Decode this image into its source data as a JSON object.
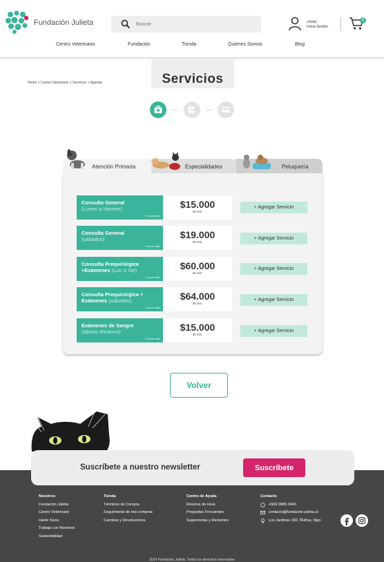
{
  "brand": "Fundación Julieta",
  "search": {
    "placeholder": "Buscar"
  },
  "user": {
    "greeting": "¡Hola!",
    "login": "Inicia Sesión"
  },
  "cart": {
    "count": "0"
  },
  "nav": [
    "Centro Veterinario",
    "Fundación",
    "Tienda",
    "Quienes Somos",
    "Blog"
  ],
  "breadcrumb": "Home > Centro Veterinario > Servicios > Agenda",
  "page_title": "Servicios",
  "tabs": [
    "Atención Primaria",
    "Especialidades",
    "Peluquería"
  ],
  "services": [
    {
      "name": "Consulta General",
      "sub": "(Lunes a Viernes)",
      "price": "$15.000",
      "duration": "30 min.",
      "more": "Conoce Más",
      "add": "+ Agregar Servicio"
    },
    {
      "name": "Consulta General",
      "sub": "(sábados)",
      "price": "$19.000",
      "duration": "30 min.",
      "more": "Conoce Más",
      "add": "+ Agregar Servicio"
    },
    {
      "name": "Consulta Prequirúrgica +Exámenes",
      "sub": "(Lun a Vie)",
      "price": "$60.000",
      "duration": "30 min.",
      "more": "Conoce Más",
      "add": "+ Agregar Servicio"
    },
    {
      "name": "Consulta Prequirúrgica + Exámenes",
      "sub": "(sábados)",
      "price": "$64.000",
      "duration": "30 min.",
      "more": "Conoce Más",
      "add": "+ Agregar Servicio"
    },
    {
      "name": "Exámenes de Sangre",
      "sub": "(Abono Reserva)",
      "price": "$15.000",
      "duration": "30 min.",
      "more": "Conoce Más",
      "add": "+ Agregar Servicio"
    }
  ],
  "back_button": "Volver",
  "newsletter": {
    "text": "Suscríbete a nuestro newsletter",
    "button": "Suscríbete"
  },
  "footer": {
    "cols": [
      {
        "title": "Nosotros",
        "links": [
          "Fundación Julieta",
          "Centro Veterinario",
          "Hazte Socio",
          "Trabaja con Nosotros",
          "Sostenibilidad"
        ]
      },
      {
        "title": "Tienda",
        "links": [
          "Términos de Compra",
          "Seguimiento de mis compras",
          "Cambios y Devoluciones"
        ]
      },
      {
        "title": "Centro de Ayuda",
        "links": [
          "Reserva de Hora",
          "Preguntas Frecuentes",
          "Sugerencias y Reclamos"
        ]
      }
    ],
    "contact": {
      "title": "Contacto",
      "phone": "+569 9885 0443",
      "email": "contacto@fundacion.julieta.cl",
      "address": "Los Jardines 300, Ñuñoa, Stgo"
    },
    "copyright": "2024 Fundación Julieta. Todos los derechos reservados"
  },
  "icons": {
    "search": "search-icon",
    "user": "user-icon",
    "cart": "cart-icon",
    "facebook": "facebook-icon",
    "instagram": "instagram-icon"
  },
  "colors": {
    "accent": "#3ab49a",
    "accent_light": "#c1e8dd",
    "newsletter_button": "#d6246a",
    "footer_bg": "#474646"
  }
}
